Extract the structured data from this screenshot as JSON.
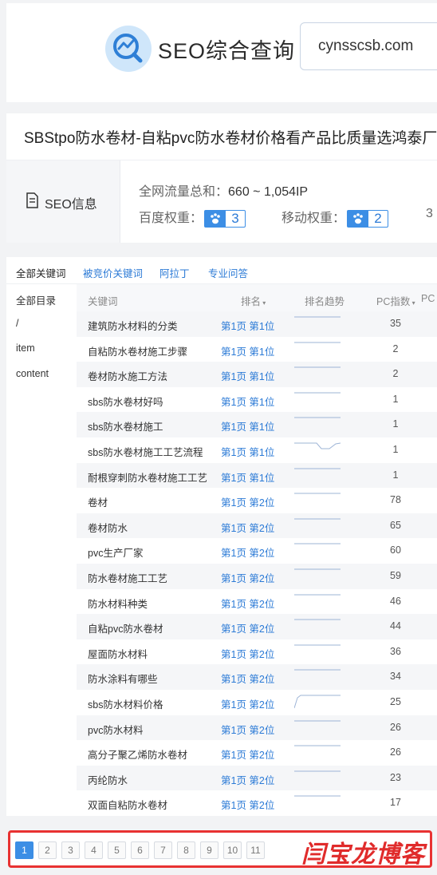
{
  "header": {
    "tool_title": "SEO综合查询",
    "domain_value": "cynsscsb.com"
  },
  "site_title": "SBStpo防水卷材-自粘pvc防水卷材价格看产品比质量选鸿泰厂",
  "seo_info": {
    "label": "SEO信息",
    "traffic_label": "全网流量总和：",
    "traffic_value": "660 ~ 1,054IP",
    "baidu_weight_label": "百度权重：",
    "baidu_weight_value": "3",
    "mobile_weight_label": "移动权重：",
    "mobile_weight_value": "2",
    "cut_value": "3"
  },
  "keywords": {
    "tabs": [
      {
        "label": "全部关键词"
      },
      {
        "label": "被竞价关键词"
      },
      {
        "label": "阿拉丁"
      },
      {
        "label": "专业问答"
      }
    ],
    "sidebar": [
      {
        "label": "全部目录"
      },
      {
        "label": "/"
      },
      {
        "label": "item"
      },
      {
        "label": "content"
      }
    ],
    "columns": {
      "keyword": "关键词",
      "rank": "排名",
      "trend": "排名趋势",
      "pc_index": "PC指数",
      "pc_cut": "PC"
    },
    "rows": [
      {
        "keyword": "建筑防水材料的分类",
        "rank": "第1页 第1位",
        "pc": "35"
      },
      {
        "keyword": "自粘防水卷材施工步骤",
        "rank": "第1页 第1位",
        "pc": "2"
      },
      {
        "keyword": "卷材防水施工方法",
        "rank": "第1页 第1位",
        "pc": "2"
      },
      {
        "keyword": "sbs防水卷材好吗",
        "rank": "第1页 第1位",
        "pc": "1"
      },
      {
        "keyword": "sbs防水卷材施工",
        "rank": "第1页 第1位",
        "pc": "1"
      },
      {
        "keyword": "sbs防水卷材施工工艺流程",
        "rank": "第1页 第1位",
        "pc": "1"
      },
      {
        "keyword": "耐根穿刺防水卷材施工工艺",
        "rank": "第1页 第1位",
        "pc": "1"
      },
      {
        "keyword": "卷材",
        "rank": "第1页 第2位",
        "pc": "78"
      },
      {
        "keyword": "卷材防水",
        "rank": "第1页 第2位",
        "pc": "65"
      },
      {
        "keyword": "pvc生产厂家",
        "rank": "第1页 第2位",
        "pc": "60"
      },
      {
        "keyword": "防水卷材施工工艺",
        "rank": "第1页 第2位",
        "pc": "59"
      },
      {
        "keyword": "防水材料种类",
        "rank": "第1页 第2位",
        "pc": "46"
      },
      {
        "keyword": "自粘pvc防水卷材",
        "rank": "第1页 第2位",
        "pc": "44"
      },
      {
        "keyword": "屋面防水材料",
        "rank": "第1页 第2位",
        "pc": "36"
      },
      {
        "keyword": "防水涂料有哪些",
        "rank": "第1页 第2位",
        "pc": "34"
      },
      {
        "keyword": "sbs防水材料价格",
        "rank": "第1页 第2位",
        "pc": "25"
      },
      {
        "keyword": "pvc防水材料",
        "rank": "第1页 第2位",
        "pc": "26"
      },
      {
        "keyword": "高分子聚乙烯防水卷材",
        "rank": "第1页 第2位",
        "pc": "26"
      },
      {
        "keyword": "丙纶防水",
        "rank": "第1页 第2位",
        "pc": "23"
      },
      {
        "keyword": "双面自粘防水卷材",
        "rank": "第1页 第2位",
        "pc": "17"
      }
    ]
  },
  "pagination": {
    "pages": [
      "1",
      "2",
      "3",
      "4",
      "5",
      "6",
      "7",
      "8",
      "9",
      "10",
      "11"
    ],
    "current": "1"
  },
  "watermark": "闫宝龙博客",
  "colors": {
    "accent_blue": "#2b7ad6",
    "badge_blue": "#3c8ee5",
    "highlight_red": "#e83232"
  }
}
